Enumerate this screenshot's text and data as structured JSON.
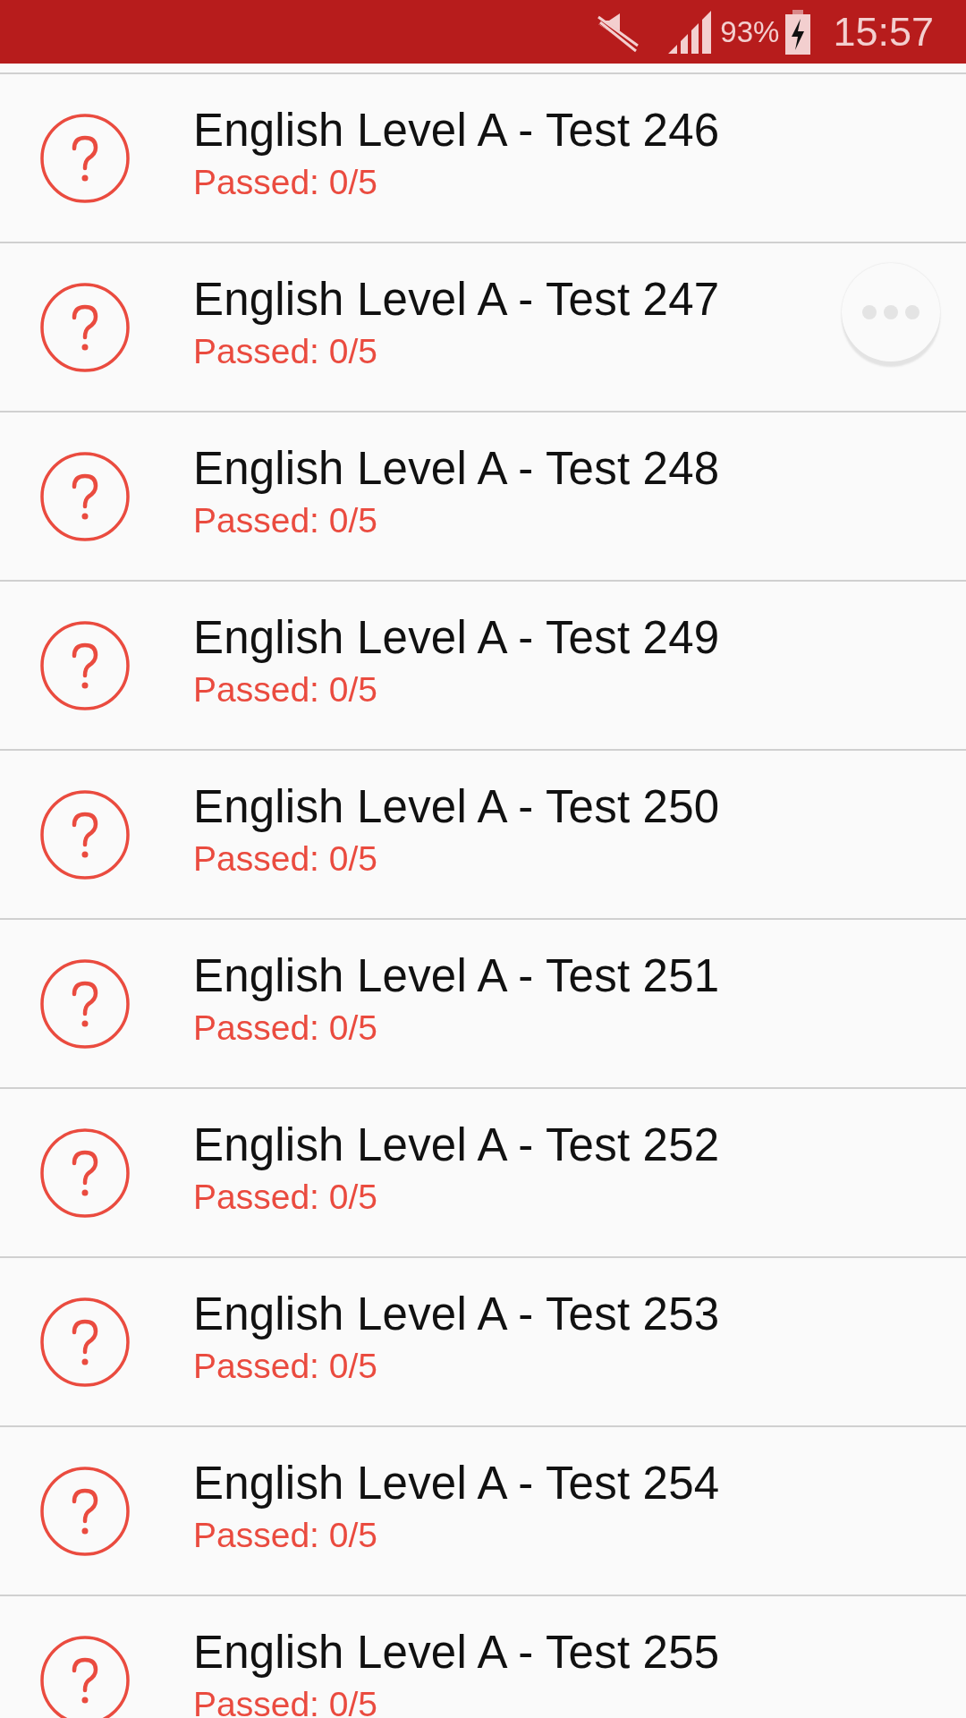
{
  "status_bar": {
    "battery": "93%",
    "time": "15:57"
  },
  "tests": [
    {
      "title": "English Level A - Test 246",
      "status": "Passed: 0/5"
    },
    {
      "title": "English Level A - Test 247",
      "status": "Passed: 0/5"
    },
    {
      "title": "English Level A - Test 248",
      "status": "Passed: 0/5"
    },
    {
      "title": "English Level A - Test 249",
      "status": "Passed: 0/5"
    },
    {
      "title": "English Level A - Test 250",
      "status": "Passed: 0/5"
    },
    {
      "title": "English Level A - Test 251",
      "status": "Passed: 0/5"
    },
    {
      "title": "English Level A - Test 252",
      "status": "Passed: 0/5"
    },
    {
      "title": "English Level A - Test 253",
      "status": "Passed: 0/5"
    },
    {
      "title": "English Level A - Test 254",
      "status": "Passed: 0/5"
    },
    {
      "title": "English Level A - Test 255",
      "status": "Passed: 0/5"
    }
  ]
}
